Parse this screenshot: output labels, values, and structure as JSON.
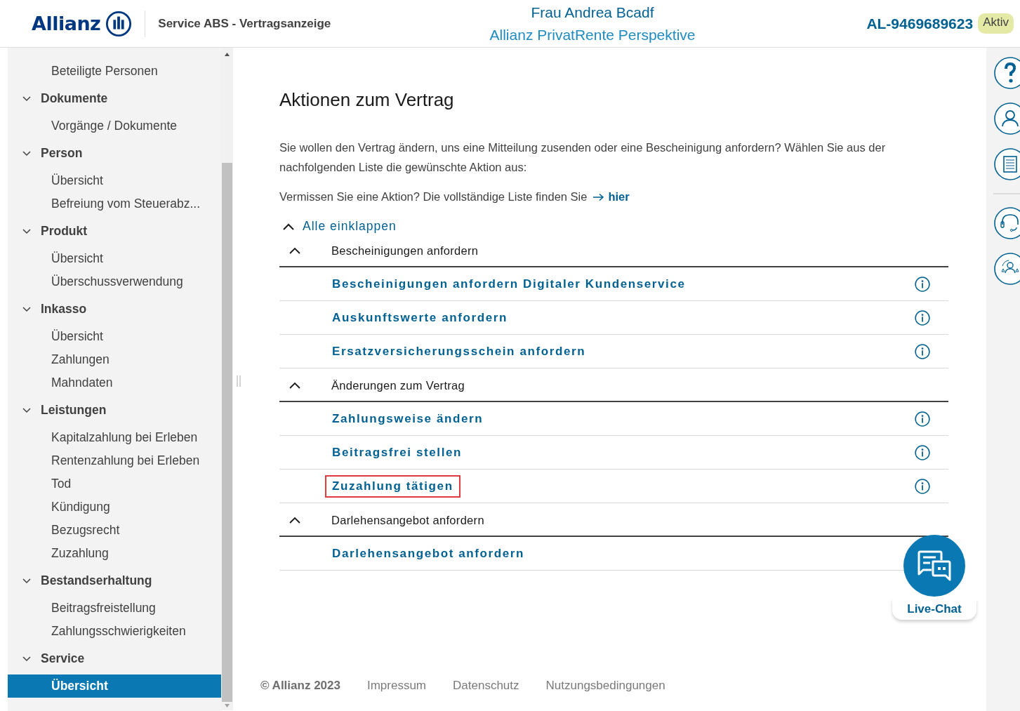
{
  "header": {
    "logo": "Allianz",
    "app_title": "Service ABS - Vertragsanzeige",
    "customer": "Frau Andrea Bcadf",
    "product": "Allianz PrivatRente Perspektive",
    "contract_number": "AL-9469689623",
    "status": "Aktiv"
  },
  "sidebar": {
    "items": [
      {
        "label": "Beteiligte Personen",
        "selected": false
      },
      {
        "label": "Dokumente",
        "expanded": true,
        "children": [
          {
            "label": "Vorgänge / Dokumente",
            "selected": false
          }
        ]
      },
      {
        "label": "Person",
        "expanded": true,
        "children": [
          {
            "label": "Übersicht",
            "selected": false
          },
          {
            "label": "Befreiung vom Steuerabz...",
            "selected": false
          }
        ]
      },
      {
        "label": "Produkt",
        "expanded": true,
        "children": [
          {
            "label": "Übersicht",
            "selected": false
          },
          {
            "label": "Überschussverwendung",
            "selected": false
          }
        ]
      },
      {
        "label": "Inkasso",
        "expanded": true,
        "children": [
          {
            "label": "Übersicht",
            "selected": false
          },
          {
            "label": "Zahlungen",
            "selected": false
          },
          {
            "label": "Mahndaten",
            "selected": false
          }
        ]
      },
      {
        "label": "Leistungen",
        "expanded": true,
        "children": [
          {
            "label": "Kapitalzahlung bei Erleben",
            "selected": false
          },
          {
            "label": "Rentenzahlung bei Erleben",
            "selected": false
          },
          {
            "label": "Tod",
            "selected": false
          },
          {
            "label": "Kündigung",
            "selected": false
          },
          {
            "label": "Bezugsrecht",
            "selected": false
          },
          {
            "label": "Zuzahlung",
            "selected": false
          }
        ]
      },
      {
        "label": "Bestandserhaltung",
        "expanded": true,
        "children": [
          {
            "label": "Beitragsfreistellung",
            "selected": false
          },
          {
            "label": "Zahlungsschwierigkeiten",
            "selected": false
          }
        ]
      },
      {
        "label": "Service",
        "expanded": true,
        "children": [
          {
            "label": "Übersicht",
            "selected": true
          }
        ]
      }
    ]
  },
  "main": {
    "title": "Aktionen zum Vertrag",
    "intro": "Sie wollen den Vertrag ändern, uns eine Mitteilung zusenden oder eine Bescheinigung anfordern? Wählen Sie aus der nachfolgenden Liste die gewünschte Aktion aus:",
    "missing_text": "Vermissen Sie eine Aktion? Die vollständige Liste finden Sie",
    "missing_link": "hier",
    "collapse_all": "Alle einklappen",
    "sections": [
      {
        "title": "Bescheinigungen anfordern",
        "expanded": true,
        "actions": [
          {
            "kind": "info",
            "label": "Bescheinigungen anfordern Digitaler Kundenservice",
            "highlighted": false
          },
          {
            "kind": "info",
            "label": "Auskunftswerte anfordern",
            "highlighted": false
          },
          {
            "kind": "info",
            "label": "Ersatzversicherungsschein anfordern",
            "highlighted": false
          }
        ]
      },
      {
        "title": "Änderungen zum Vertrag",
        "expanded": true,
        "actions": [
          {
            "kind": "info",
            "label": "Zahlungsweise ändern",
            "highlighted": false
          },
          {
            "kind": "info",
            "label": "Beitragsfrei stellen",
            "highlighted": false
          },
          {
            "kind": "info",
            "label": "Zuzahlung tätigen",
            "highlighted": true
          }
        ]
      },
      {
        "title": "Darlehensangebot anfordern",
        "expanded": true,
        "actions": [
          {
            "kind": "plain",
            "label": "Darlehensangebot anfordern",
            "highlighted": false
          }
        ]
      }
    ],
    "live_chat": "Live-Chat"
  },
  "footer": {
    "copyright": "© Allianz 2023",
    "links": [
      "Impressum",
      "Datenschutz",
      "Nutzungsbedingungen"
    ]
  },
  "right_rail": {
    "tools": [
      {
        "kind": "help"
      },
      {
        "kind": "person"
      },
      {
        "kind": "document"
      },
      {
        "kind": "divider"
      },
      {
        "kind": "headset"
      },
      {
        "kind": "team"
      }
    ]
  }
}
